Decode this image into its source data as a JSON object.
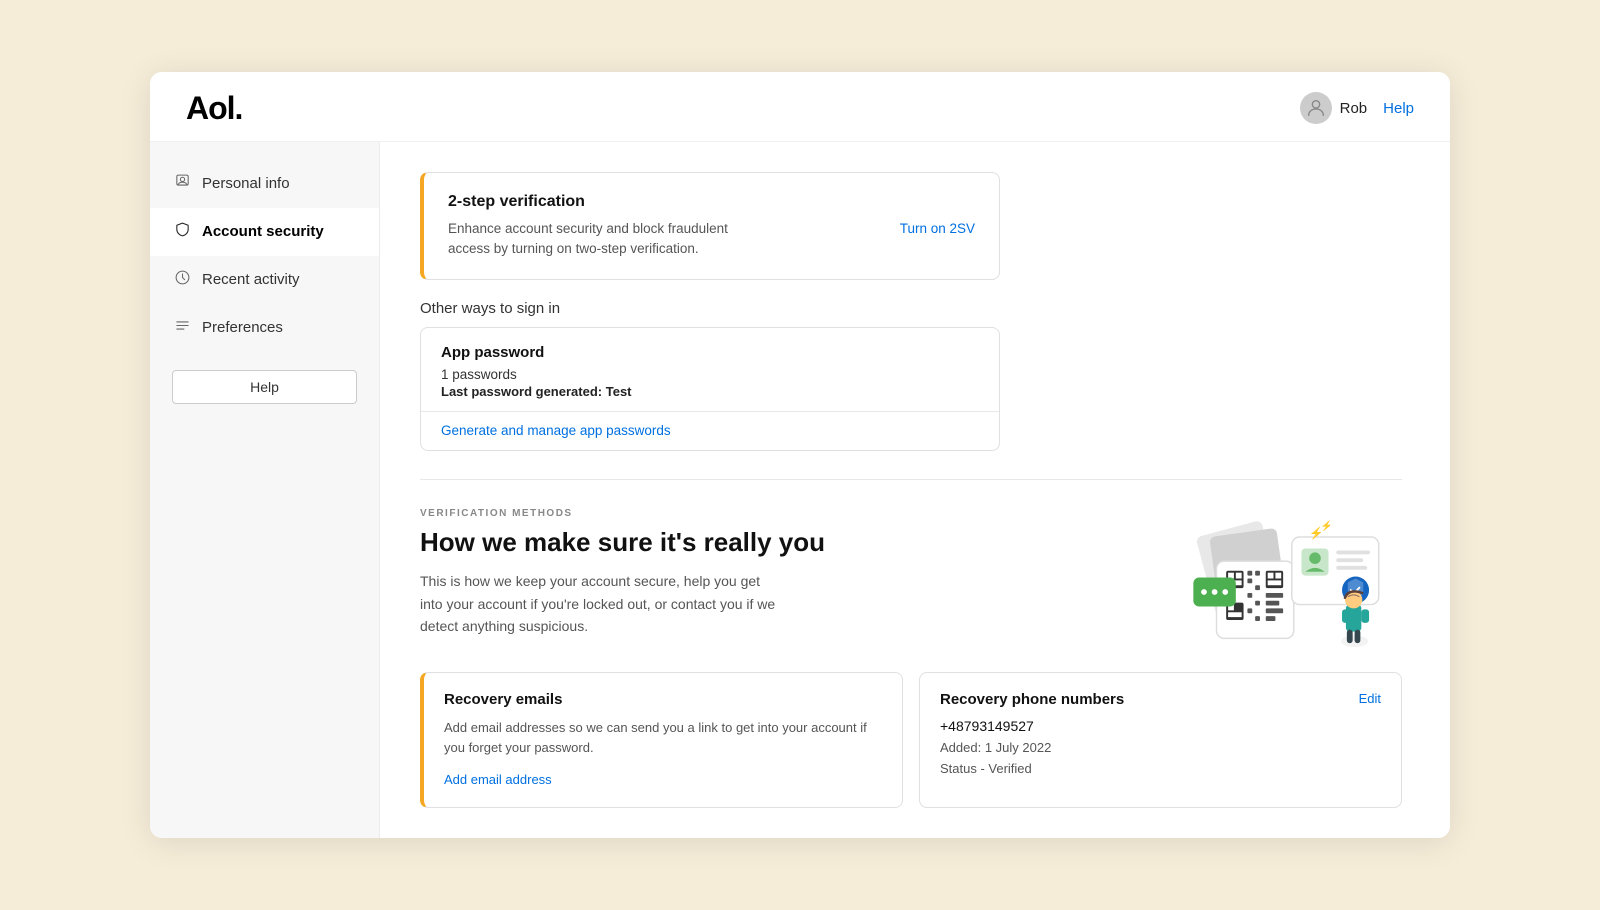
{
  "header": {
    "logo": "Aol.",
    "username": "Rob",
    "help_label": "Help"
  },
  "sidebar": {
    "items": [
      {
        "id": "personal-info",
        "label": "Personal info",
        "icon": "person",
        "active": false
      },
      {
        "id": "account-security",
        "label": "Account security",
        "icon": "shield",
        "active": true
      },
      {
        "id": "recent-activity",
        "label": "Recent activity",
        "icon": "clock",
        "active": false
      },
      {
        "id": "preferences",
        "label": "Preferences",
        "icon": "list",
        "active": false
      }
    ],
    "help_button": "Help"
  },
  "two_step": {
    "title": "2-step verification",
    "description": "Enhance account security and block fraudulent access by turning on two-step verification.",
    "action_label": "Turn on 2SV"
  },
  "other_ways": {
    "section_label": "Other ways to sign in",
    "app_password": {
      "title": "App password",
      "count": "1 passwords",
      "last_generated_label": "Last password generated:",
      "last_generated_value": "Test",
      "footer_link": "Generate and manage app passwords"
    }
  },
  "verification_methods": {
    "tag": "VERIFICATION METHODS",
    "heading": "How we make sure it's really you",
    "description": "This is how we keep your account secure, help you get into your account if you're locked out, or contact you if we detect anything suspicious."
  },
  "recovery_emails": {
    "title": "Recovery emails",
    "description": "Add email addresses so we can send you a link to get into your account if you forget your password.",
    "link": "Add email address"
  },
  "recovery_phone": {
    "title": "Recovery phone numbers",
    "phone_number": "+48793149527",
    "added_label": "Added: 1 July 2022",
    "status_label": "Status - Verified",
    "edit_label": "Edit"
  }
}
